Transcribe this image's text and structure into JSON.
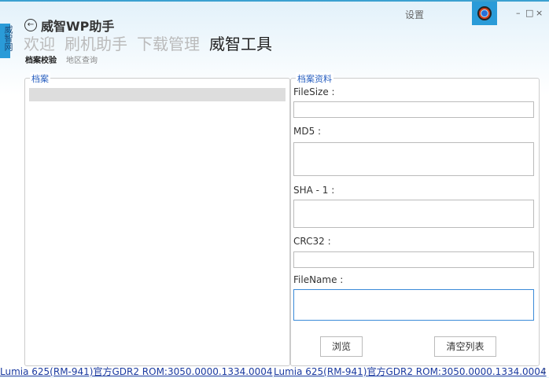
{
  "sidebar_tab": "威智网",
  "app_title": "威智WP助手",
  "nav": [
    "欢迎",
    "刷机助手",
    "下载管理",
    "威智工具"
  ],
  "subnav": [
    "档案校验",
    "地区查询"
  ],
  "settings": "设置",
  "window": {
    "minimize": "–",
    "maximize": "□",
    "close": "×"
  },
  "file_group": "档案",
  "info_group": "档案资料",
  "fields": {
    "filesize": "FileSize :",
    "md5": "MD5 :",
    "sha1": "SHA - 1 :",
    "crc32": "CRC32 :",
    "filename": "FileName :"
  },
  "buttons": {
    "browse": "浏览",
    "clear": "清空列表"
  },
  "status": {
    "left": "Lumia 625(RM-941)官方GDR2 ROM:3050.0000.1334.0004",
    "right": "Lumia 625(RM-941)官方GDR2 ROM:3050.0000.1334.0004",
    "grip": ".:"
  }
}
